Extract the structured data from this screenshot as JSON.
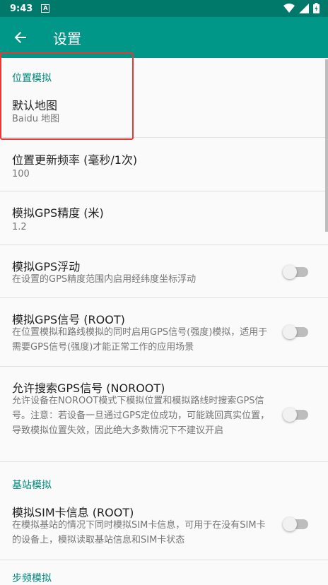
{
  "statusbar": {
    "time": "9:43",
    "notification_letter": "A"
  },
  "appbar": {
    "title": "设置"
  },
  "sections": {
    "location": "位置模拟",
    "cell": "基站模拟",
    "step": "步频模拟"
  },
  "prefs": {
    "default_map": {
      "title": "默认地图",
      "summary": "Baidu 地图"
    },
    "update_freq": {
      "title": "位置更新频率 (毫秒/1次)",
      "summary": "100"
    },
    "gps_accuracy": {
      "title": "模拟GPS精度 (米)",
      "summary": "1.2"
    },
    "gps_float": {
      "title": "模拟GPS浮动",
      "summary": "在设置的GPS精度范围内启用经纬度坐标浮动",
      "enabled": false
    },
    "gps_signal": {
      "title": "模拟GPS信号 (ROOT)",
      "summary": "在位置模拟和路线模拟的同时启用GPS信号(强度)模拟，适用于需要GPS信号(强度)才能正常工作的应用场景",
      "enabled": false
    },
    "gps_search": {
      "title": "允许搜索GPS信号 (NOROOT)",
      "summary": "允许设备在NOROOT模式下模拟位置和模拟路线时搜索GPS信号。注意：若设备一旦通过GPS定位成功，可能跳回真实位置，导致模拟位置失效，因此绝大多数情况下不建议开启",
      "enabled": false
    },
    "sim_info": {
      "title": "模拟SIM卡信息 (ROOT)",
      "summary": "在模拟基站的情况下同时模拟SIM卡信息，可用于在没有SIM卡的设备上，模拟读取基站信息和SIM卡状态",
      "enabled": false
    }
  },
  "colors": {
    "primary": "#009688",
    "primary_dark": "#00796b",
    "accent_text": "#00897b",
    "highlight_box": "#e53935"
  }
}
